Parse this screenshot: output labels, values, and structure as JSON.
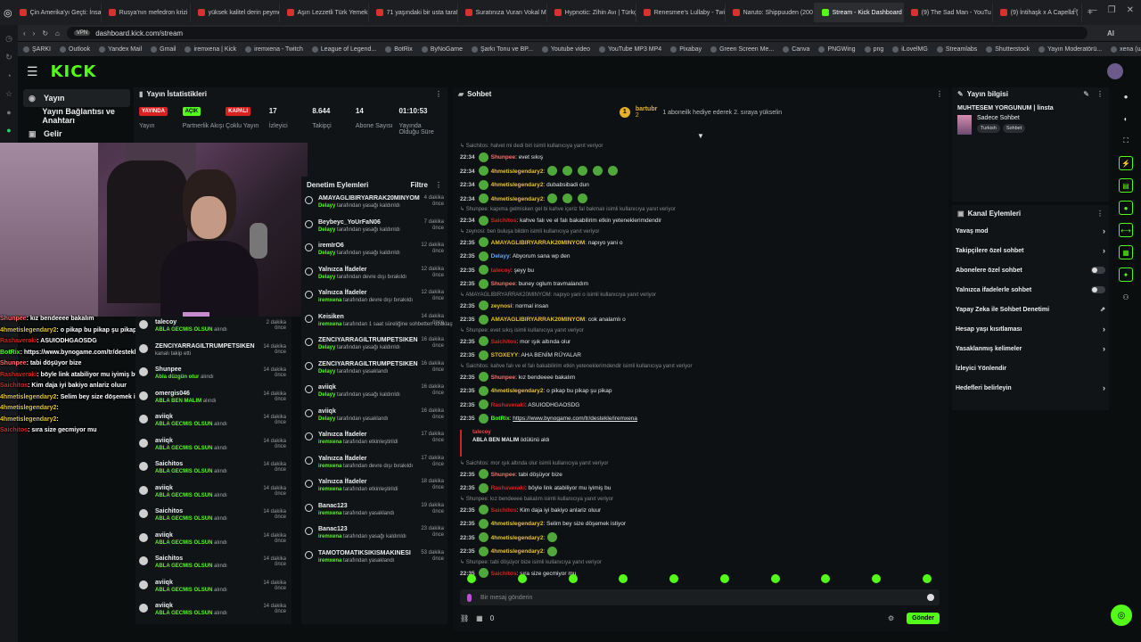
{
  "browser": {
    "tabs": [
      {
        "label": "Çin Amerika'yı Geçti: İnsa",
        "active": false
      },
      {
        "label": "Rusya'nın mefedron krizi",
        "active": false
      },
      {
        "label": "yüksek kalitel derin peyme",
        "active": false
      },
      {
        "label": "Aşırı Lezzetli Türk Yemek",
        "active": false
      },
      {
        "label": "71 yaşındaki bir usta taraf",
        "active": false
      },
      {
        "label": "Suratınıza Vuran Vokal M",
        "active": false
      },
      {
        "label": "Hypnotic: Zihin Avı | Türkç",
        "active": false
      },
      {
        "label": "Renesmee's Lullaby - Twili",
        "active": false
      },
      {
        "label": "Naruto: Shippuuden (200",
        "active": false
      },
      {
        "label": "Stream - Kick Dashboard",
        "active": true
      },
      {
        "label": "(9) The Sad Man - YouTu",
        "active": false
      },
      {
        "label": "(9) İntihaşk x A Capella (",
        "active": false
      }
    ],
    "url": "dashboard.kick.com/stream",
    "vpn_label": "VPN",
    "ai_label": "AI",
    "bookmarks": [
      "ŞARKI",
      "Outlook",
      "Yandex Mail",
      "Gmail",
      "iremxena | Kick",
      "iremxena - Twitch",
      "League of Legend...",
      "BotRix",
      "ByNoGame",
      "Şarkı Tonu ve BP...",
      "Youtube video",
      "YouTube MP3 MP4",
      "Pixabay",
      "Green Screen Me...",
      "Canva",
      "PNGWing",
      "png",
      "iLovelMG",
      "Streamlabs",
      "Shutterstock",
      "Yayın Moderatörü...",
      "xena (u/iremxena)..."
    ]
  },
  "kick": {
    "logo": "KICK",
    "sidebar": [
      {
        "label": "Yayın",
        "icon": "broadcast-icon",
        "active": true
      },
      {
        "label": "Yayın Bağlantısı ve Anahtarı",
        "icon": "key-icon",
        "active": false
      },
      {
        "label": "Gelir",
        "icon": "wallet-icon",
        "active": false
      }
    ]
  },
  "stats": {
    "title": "Yayın İstatistikleri",
    "items": [
      {
        "pill": "YAYINDA",
        "pill_color": "#d7221f",
        "value": "",
        "label": "Yayın"
      },
      {
        "pill": "AÇIK",
        "pill_color": "#53fc18",
        "value": "",
        "label": "Partnerlik Akışı"
      },
      {
        "pill": "KAPALI",
        "pill_color": "#d7221f",
        "value": "",
        "label": "Çoklu Yayın"
      },
      {
        "pill": "",
        "value": "17",
        "label": "İzleyici"
      },
      {
        "pill": "",
        "value": "8.644",
        "label": "Takipçi"
      },
      {
        "pill": "",
        "value": "14",
        "label": "Abone Sayısı"
      },
      {
        "pill": "",
        "value": "01:10:53",
        "label": "Yayında Olduğu Süre"
      }
    ]
  },
  "overlay_chat": [
    {
      "user": "Shunpee",
      "color": "#ff6b6b",
      "text": ": kız bendeeee bakalım"
    },
    {
      "user": "4hmetislegendary2",
      "color": "#e6c12b",
      "text": ": o pikap bu pikap şu pikap"
    },
    {
      "user": "Rashaveraki",
      "color": "#d7221f",
      "text": ": ASUIODHGAOSDG"
    },
    {
      "user": "BotRix",
      "color": "#53fc18",
      "text": ": https://www.bynogame.com/tr/destekle/iremxena"
    },
    {
      "user": "Shunpee",
      "color": "#ff6b6b",
      "text": ": tabi döşüyor bize"
    },
    {
      "user": "Rashaveraki",
      "color": "#d7221f",
      "text": ": böyle link atabiliyor mu iyimiş bu"
    },
    {
      "user": "Saichitos",
      "color": "#d7221f",
      "text": ": Kim daja iyi bakiyo anlariz oluur"
    },
    {
      "user": "4hmetislegendary2",
      "color": "#e6c12b",
      "text": ": Selim bey size döşemek istiyor"
    },
    {
      "user": "4hmetislegendary2",
      "color": "#e6c12b",
      "text": ":"
    },
    {
      "user": "4hmetislegendary2",
      "color": "#e6c12b",
      "text": ":"
    },
    {
      "user": "Saichitos",
      "color": "#d7221f",
      "text": ": sıra size gecmiyor mu"
    }
  ],
  "rewards": [
    {
      "user": "talecoy",
      "reward": "ABLA GECMIS OLSUN",
      "suffix": "alındı",
      "time": "2 dakika önce"
    },
    {
      "user": "ZENCIYARRAGILTRUMPETSIKEN",
      "reward": "",
      "suffix": "kanalı takip etti",
      "time": "14 dakika önce"
    },
    {
      "user": "Shunpee",
      "reward": "Abla düzgün otur",
      "suffix": "alındı",
      "time": "14 dakika önce"
    },
    {
      "user": "omergis046",
      "reward": "ABLA BEN MALIM",
      "suffix": "alındı",
      "time": "14 dakika önce"
    },
    {
      "user": "aviiqk",
      "reward": "ABLA GECMIS OLSUN",
      "suffix": "alındı",
      "time": "14 dakika önce"
    },
    {
      "user": "aviiqk",
      "reward": "ABLA GECMIS OLSUN",
      "suffix": "alındı",
      "time": "14 dakika önce"
    },
    {
      "user": "Saichitos",
      "reward": "ABLA GECMIS OLSUN",
      "suffix": "alındı",
      "time": "14 dakika önce"
    },
    {
      "user": "aviiqk",
      "reward": "ABLA GECMIS OLSUN",
      "suffix": "alındı",
      "time": "14 dakika önce"
    },
    {
      "user": "Saichitos",
      "reward": "ABLA GECMIS OLSUN",
      "suffix": "alındı",
      "time": "14 dakika önce"
    },
    {
      "user": "aviiqk",
      "reward": "ABLA GECMIS OLSUN",
      "suffix": "alındı",
      "time": "14 dakika önce"
    },
    {
      "user": "Saichitos",
      "reward": "ABLA GECMIS OLSUN",
      "suffix": "alındı",
      "time": "14 dakika önce"
    },
    {
      "user": "aviiqk",
      "reward": "ABLA GECMIS OLSUN",
      "suffix": "alındı",
      "time": "14 dakika önce"
    },
    {
      "user": "aviiqk",
      "reward": "ABLA GECMIS OLSUN",
      "suffix": "alındı",
      "time": "14 dakika önce"
    }
  ],
  "moderation": {
    "title": "Denetim Eylemleri",
    "filter_label": "Filtre",
    "items": [
      {
        "name": "AMAYAGLIBIRYARRAK20MINYOM",
        "actor": "Delayy",
        "action": "tarafından yasağı kaldırıldı",
        "time": "4 dakika önce"
      },
      {
        "name": "Beybeyc_YoUrFaN06",
        "actor": "Delayy",
        "action": "tarafından yasağı kaldırıldı",
        "time": "7 dakika önce"
      },
      {
        "name": "iremIrO6",
        "actor": "Delayy",
        "action": "tarafından yasağı kaldırıldı",
        "time": "12 dakika önce"
      },
      {
        "name": "Yalnızca İfadeler",
        "actor": "Delayy",
        "action": "tarafından devre dışı bırakıldı",
        "time": "12 dakika önce"
      },
      {
        "name": "Yalnızca İfadeler",
        "actor": "iremxena",
        "action": "tarafından devre dışı bırakıldı",
        "time": "12 dakika önce"
      },
      {
        "name": "Keisiken",
        "actor": "iremxena",
        "action": "tarafından 1 saat süreliğine sohbetten uzaklaştırıldı",
        "time": "14 dakika önce"
      },
      {
        "name": "ZENCIYARRAGILTRUMPETSIKEN",
        "actor": "Delayy",
        "action": "tarafından yasağı kaldırıldı",
        "time": "16 dakika önce"
      },
      {
        "name": "ZENCIYARRAGILTRUMPETSIKEN",
        "actor": "Delayy",
        "action": "tarafından yasaklandı",
        "time": "16 dakika önce"
      },
      {
        "name": "aviiqk",
        "actor": "Delayy",
        "action": "tarafından yasağı kaldırıldı",
        "time": "16 dakika önce"
      },
      {
        "name": "aviiqk",
        "actor": "Delayy",
        "action": "tarafından yasaklandı",
        "time": "16 dakika önce"
      },
      {
        "name": "Yalnızca İfadeler",
        "actor": "iremxena",
        "action": "tarafından etkinleştirildi",
        "time": "17 dakika önce"
      },
      {
        "name": "Yalnızca İfadeler",
        "actor": "iremxena",
        "action": "tarafından devre dışı bırakıldı",
        "time": "17 dakika önce"
      },
      {
        "name": "Yalnızca İfadeler",
        "actor": "iremxena",
        "action": "tarafından etkinleştirildi",
        "time": "18 dakika önce"
      },
      {
        "name": "Banac123",
        "actor": "iremxena",
        "action": "tarafından yasaklandı",
        "time": "19 dakika önce"
      },
      {
        "name": "Banac123",
        "actor": "iremxena",
        "action": "tarafından yasağı kaldırıldı",
        "time": "23 dakika önce"
      },
      {
        "name": "TAMOTOMATIKSIKISMAKINESI",
        "actor": "iremxena",
        "action": "tarafından yasaklandı",
        "time": "53 dakika önce"
      }
    ]
  },
  "chat": {
    "title": "Sohbet",
    "gift_user": "bartubr",
    "gift_count": "2",
    "gift_text": "1 aboneilk hediye ederek 2. sıraya yükselin",
    "input_placeholder": "Bir mesaj gönderin",
    "send_label": "Gönder",
    "points": "0",
    "lines": [
      {
        "type": "reply",
        "text": "Saichitos: halvet mi dedi biri isimli kullanıcıya yanıt veriyor"
      },
      {
        "type": "msg",
        "time": "22:34",
        "user": "Shunpee",
        "color": "#ff6b6b",
        "text": ": evet sıkış",
        "emotes": 0
      },
      {
        "type": "msg",
        "time": "22:34",
        "user": "4hmetislegendary2",
        "color": "#e6c12b",
        "text": ":",
        "emotes": 5
      },
      {
        "type": "msg",
        "time": "22:34",
        "user": "4hmetislegendary2",
        "color": "#e6c12b",
        "text": ": dubabsibadi dun",
        "emotes": 0
      },
      {
        "type": "msg",
        "time": "22:34",
        "user": "4hmetislegendary2",
        "color": "#e6c12b",
        "text": ":",
        "emotes": 3
      },
      {
        "type": "reply",
        "text": "Shunpee: kapıma gelmisken gel bi kahve içeriz fal bakmalı isimli kullanıcıya yanıt veriyor"
      },
      {
        "type": "msg",
        "time": "22:34",
        "user": "Saichitos",
        "color": "#d7221f",
        "text": ": kahve falı ve el falı bakabilirim etkin yeteneklerimdendir",
        "emotes": 0
      },
      {
        "type": "reply",
        "text": "zeynosi: ben buluşa bildim isimli kullanıcıya yanıt veriyor"
      },
      {
        "type": "msg",
        "time": "22:35",
        "user": "AMAYAGLIBIRYARRAK20MINYOM",
        "color": "#e6c12b",
        "text": ": napıyo yani o",
        "emotes": 0
      },
      {
        "type": "msg",
        "time": "22:35",
        "user": "Delayy",
        "color": "#5aa7ff",
        "text": ": Abyorum sana wp den",
        "emotes": 0
      },
      {
        "type": "msg",
        "time": "22:35",
        "user": "talecoy",
        "color": "#d7221f",
        "text": ": şeyy bu",
        "emotes": 0
      },
      {
        "type": "msg",
        "time": "22:35",
        "user": "Shunpee",
        "color": "#ff6b6b",
        "text": ": buney oglum travmalandım",
        "emotes": 0
      },
      {
        "type": "reply",
        "text": "AMAYAGLIBIRYARRAK20MINYOM: napıyo yani o isimli kullanıcıya yanıt veriyor"
      },
      {
        "type": "msg",
        "time": "22:35",
        "user": "zeynosi",
        "color": "#e6c12b",
        "text": ": normal insan",
        "emotes": 0
      },
      {
        "type": "msg",
        "time": "22:35",
        "user": "AMAYAGLIBIRYARRAK20MINYOM",
        "color": "#e6c12b",
        "text": ": cok analamlı o",
        "emotes": 0
      },
      {
        "type": "reply",
        "text": "Shunpee: evet sıkış isimli kullanıcıya yanıt veriyor"
      },
      {
        "type": "msg",
        "time": "22:35",
        "user": "Saichitos",
        "color": "#d7221f",
        "text": ": mor ışık altında olur",
        "emotes": 0
      },
      {
        "type": "msg",
        "time": "22:35",
        "user": "STOXEYY",
        "color": "#e6c12b",
        "text": ": AHA BENİM RÜYALAR",
        "emotes": 0
      },
      {
        "type": "reply",
        "text": "Saichitos: kahve falı ve el falı bakabilirim etkin yeteneklerimdendir isimli kullanıcıya yanıt veriyor"
      },
      {
        "type": "msg",
        "time": "22:35",
        "user": "Shunpee",
        "color": "#ff6b6b",
        "text": ": kız bendeeee bakalım",
        "emotes": 0
      },
      {
        "type": "msg",
        "time": "22:35",
        "user": "4hmetislegendary2",
        "color": "#e6c12b",
        "text": ": o pikap bu pikap şu pikap",
        "emotes": 0
      },
      {
        "type": "msg",
        "time": "22:35",
        "user": "Rashaveraki",
        "color": "#d7221f",
        "text": ": ASUIODHGAOSDG",
        "emotes": 0
      },
      {
        "type": "msg",
        "time": "22:35",
        "user": "BotRix",
        "color": "#53fc18",
        "text": ": ",
        "link": "https://www.bynogame.com/tr/destekle/iremxena",
        "emotes": 0
      },
      {
        "type": "reward",
        "user": "talecoy",
        "text": "ABLA BEN MALIM",
        "suffix": "ödülünü aldı"
      },
      {
        "type": "reply",
        "text": "Saichitos: mor ışık altında olur isimli kullanıcıya yanıt veriyor"
      },
      {
        "type": "msg",
        "time": "22:35",
        "user": "Shunpee",
        "color": "#ff6b6b",
        "text": ": tabi döşüyor bize",
        "emotes": 0
      },
      {
        "type": "msg",
        "time": "22:35",
        "user": "Rashaveraki",
        "color": "#d7221f",
        "text": ": böyle link atabiliyor mu iyimiş bu",
        "emotes": 0
      },
      {
        "type": "reply",
        "text": "Shunpee: kız bendeeee bakalım isimli kullanıcıya yanıt veriyor"
      },
      {
        "type": "msg",
        "time": "22:35",
        "user": "Saichitos",
        "color": "#d7221f",
        "text": ": Kim daja iyi bakiyo anlariz oluur",
        "emotes": 0
      },
      {
        "type": "msg",
        "time": "22:35",
        "user": "4hmetislegendary2",
        "color": "#e6c12b",
        "text": ": Selim bey size döşemek istiyor",
        "emotes": 0
      },
      {
        "type": "msg",
        "time": "22:35",
        "user": "4hmetislegendary2",
        "color": "#e6c12b",
        "text": ":",
        "emotes": 1
      },
      {
        "type": "msg",
        "time": "22:35",
        "user": "4hmetislegendary2",
        "color": "#e6c12b",
        "text": ":",
        "emotes": 1
      },
      {
        "type": "reply",
        "text": "Shunpee: tabi döşüyor bize isimli kullanıcıya yanıt veriyor"
      },
      {
        "type": "msg",
        "time": "22:35",
        "user": "Saichitos",
        "color": "#d7221f",
        "text": ": sıra size gecmiyor mu",
        "emotes": 0
      }
    ]
  },
  "stream_info": {
    "title": "Yayın bilgisi",
    "stream_title": "MUHTESEM YORGUNUM | linsta",
    "category": "Sadece Sohbet",
    "tags": [
      "Turkish",
      "Sohbet"
    ]
  },
  "channel_actions": {
    "title": "Kanal Eylemleri",
    "items": [
      {
        "label": "Yavaş mod",
        "control": "arrow"
      },
      {
        "label": "Takipçilere özel sohbet",
        "control": "arrow"
      },
      {
        "label": "Abonelere özel sohbet",
        "control": "toggle"
      },
      {
        "label": "Yalnızca ifadelerle sohbet",
        "control": "toggle"
      },
      {
        "label": "Yapay Zeka ile Sohbet Denetimi",
        "control": "external"
      },
      {
        "label": "Hesap yaşı kısıtlaması",
        "control": "arrow"
      },
      {
        "label": "Yasaklanmış kelimeler",
        "control": "arrow"
      },
      {
        "label": "İzleyici Yönlendir",
        "control": "none"
      },
      {
        "label": "Hedefleri belirleyin",
        "control": "arrow"
      }
    ]
  }
}
